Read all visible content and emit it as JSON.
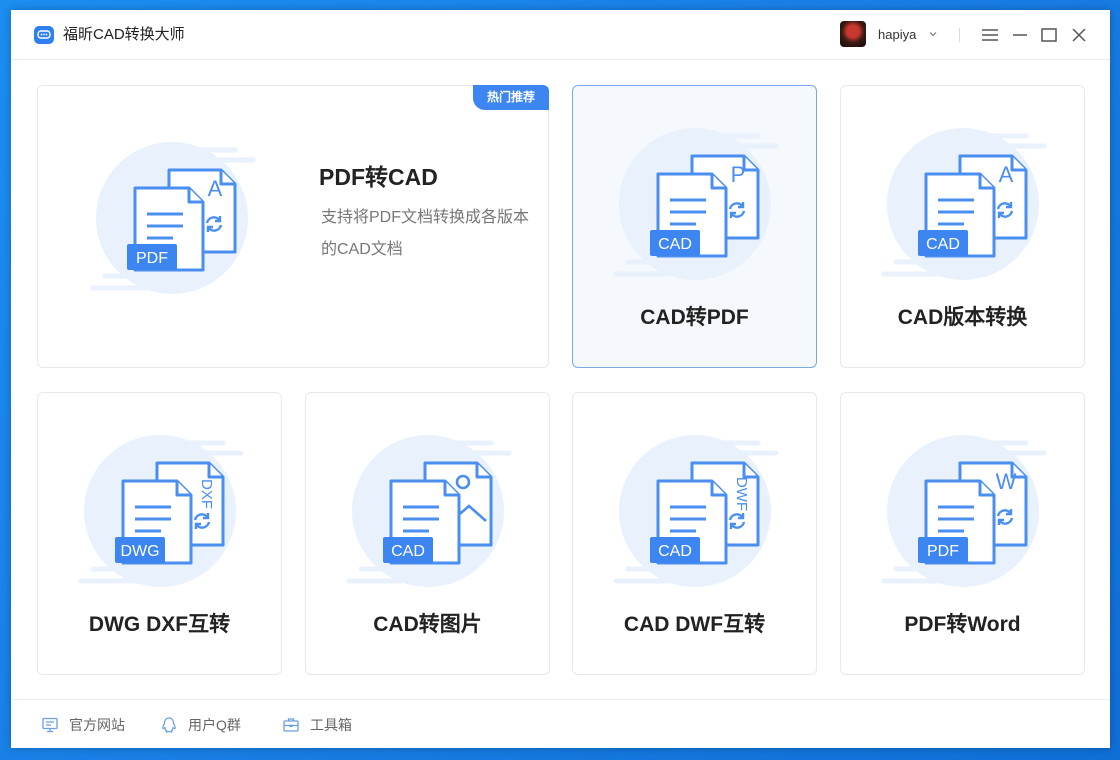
{
  "app": {
    "title": "福昕CAD转换大师",
    "user_name": "hapiya"
  },
  "colors": {
    "accent": "#3d85f0",
    "icon_blob": "#e8f1fc",
    "doc_stroke": "#4a8ef0",
    "doc_fill": "#ffffff",
    "selected_border": "#7aa9ea"
  },
  "featured": {
    "badge": "热门推荐",
    "title": "PDF转CAD",
    "description": "支持将PDF文档转换成各版本的CAD文档",
    "icon": {
      "front_label": "PDF",
      "back_label": "A"
    }
  },
  "cards": [
    {
      "title": "CAD转PDF",
      "selected": true,
      "icon": {
        "front_label": "CAD",
        "back_label": "P"
      }
    },
    {
      "title": "CAD版本转换",
      "selected": false,
      "icon": {
        "front_label": "CAD",
        "back_label": "A"
      }
    },
    {
      "title": "DWG DXF互转",
      "selected": false,
      "icon": {
        "front_label": "DWG",
        "back_label": "DXF"
      }
    },
    {
      "title": "CAD转图片",
      "selected": false,
      "icon": {
        "front_label": "CAD",
        "back_label": "image"
      }
    },
    {
      "title": "CAD DWF互转",
      "selected": false,
      "icon": {
        "front_label": "CAD",
        "back_label": "DWF"
      }
    },
    {
      "title": "PDF转Word",
      "selected": false,
      "icon": {
        "front_label": "PDF",
        "back_label": "W"
      }
    }
  ],
  "footer": {
    "website": "官方网站",
    "qq_group": "用户Q群",
    "toolbox": "工具箱"
  },
  "icons": {
    "app_logo": "cad-chat-logo-icon",
    "chevron": "chevron-down-icon",
    "menu": "hamburger-menu-icon",
    "minimize": "minimize-icon",
    "maximize": "maximize-icon",
    "close": "close-icon",
    "website": "monitor-icon",
    "qq": "qq-penguin-icon",
    "toolbox": "toolbox-icon"
  }
}
